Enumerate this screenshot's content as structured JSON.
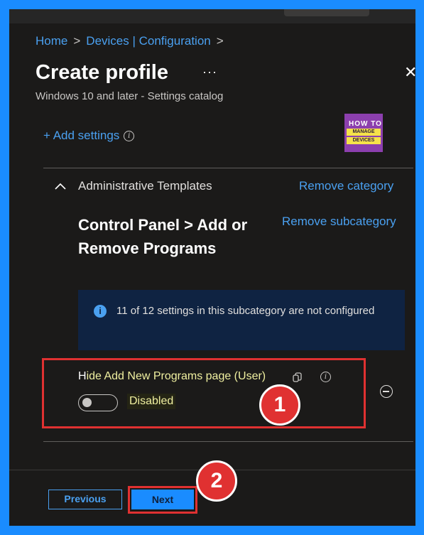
{
  "breadcrumb": {
    "items": [
      "Home",
      "Devices | Configuration"
    ],
    "sep": ">"
  },
  "header": {
    "title": "Create profile",
    "more": "···",
    "close": "✕",
    "subtitle": "Windows 10 and later - Settings catalog"
  },
  "toolbar": {
    "add_settings": "+ Add settings"
  },
  "logo": {
    "line1": "HOW TO",
    "line2": "MANAGE",
    "line3": "DEVICES"
  },
  "category": {
    "title": "Administrative Templates",
    "remove_label": "Remove category",
    "subcategory_title": "Control Panel > Add or Remove Programs",
    "remove_sub_label": "Remove subcategory",
    "info_text": "11 of 12 settings in this subcategory are not configured"
  },
  "setting": {
    "label_first": "H",
    "label_rest": "ide Add New Programs page (User)",
    "state_label": "Disabled",
    "toggle_on": false
  },
  "callouts": {
    "one": "1",
    "two": "2"
  },
  "footer": {
    "previous_label": "Previous",
    "next_label": "Next"
  },
  "colors": {
    "accent": "#1a8cff",
    "link": "#4aa0f0",
    "highlight": "#e03131",
    "panel": "#1b1a19"
  }
}
